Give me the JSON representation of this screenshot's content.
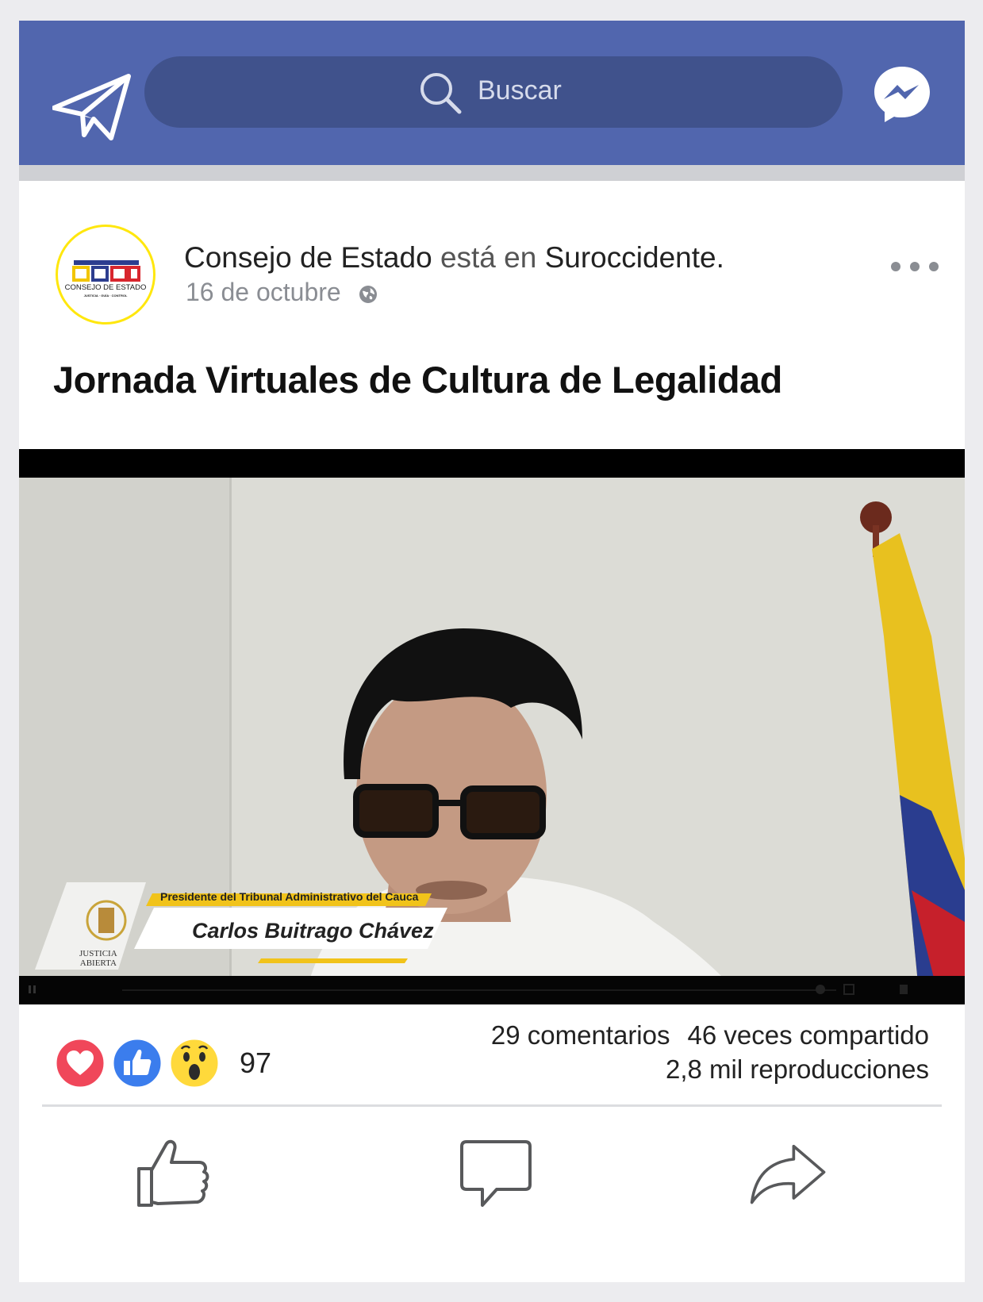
{
  "search": {
    "placeholder": "Buscar"
  },
  "post": {
    "author": "Consejo de Estado",
    "location_connector": "está en",
    "location": "Suroccidente.",
    "date": "16 de octubre",
    "title": "Jornada Virtuales de Cultura de Legalidad",
    "avatar_logo_text": "CONSEJO DE ESTADO",
    "avatar_logo_subtext": "JUSTICIA · GUÍA · CONTROL"
  },
  "video": {
    "lower_third_role": "Presidente del Tribunal Administrativo del Cauca",
    "lower_third_name": "Carlos Buitrago Chávez",
    "logo_line1": "JUSTICIA",
    "logo_line2": "ABIERTA"
  },
  "stats": {
    "reaction_count": "97",
    "comments": "29 comentarios",
    "shares": "46 veces compartido",
    "views": "2,8 mil  reproducciones"
  },
  "colors": {
    "topbar": "#5166ae",
    "searchbar": "#40528c",
    "love": "#f0475a",
    "like": "#3b7ded",
    "wow": "#ffd93b"
  },
  "icons": {
    "left_header": "send-icon",
    "right_header": "messenger-icon",
    "actions": [
      "like-icon",
      "comment-icon",
      "share-icon"
    ]
  }
}
